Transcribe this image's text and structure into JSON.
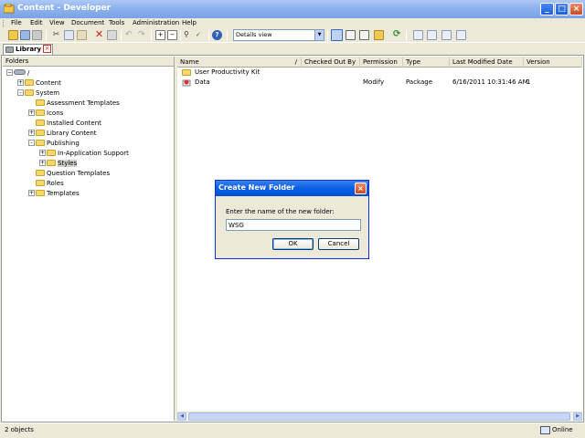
{
  "window": {
    "title": "Content - Developer"
  },
  "menu": [
    "File",
    "Edit",
    "View",
    "Document",
    "Tools",
    "Administration",
    "Help"
  ],
  "toolbar": {
    "view_select": "Details view"
  },
  "tabs": [
    {
      "label": "Library"
    }
  ],
  "folders": {
    "header": "Folders",
    "root": "/",
    "items": [
      {
        "label": "Content",
        "expander": "+"
      },
      {
        "label": "System",
        "expander": "-"
      },
      {
        "label": "Assessment Templates",
        "expander": ""
      },
      {
        "label": "Icons",
        "expander": "+"
      },
      {
        "label": "Installed Content",
        "expander": ""
      },
      {
        "label": "Library Content",
        "expander": "+"
      },
      {
        "label": "Publishing",
        "expander": "-"
      },
      {
        "label": "In-Application Support",
        "expander": "+"
      },
      {
        "label": "Styles",
        "expander": "+"
      },
      {
        "label": "Question Templates",
        "expander": ""
      },
      {
        "label": "Roles",
        "expander": ""
      },
      {
        "label": "Templates",
        "expander": "+"
      }
    ]
  },
  "list": {
    "columns": [
      "Name",
      "Checked Out By",
      "Permission",
      "Type",
      "Last Modified Date",
      "Version"
    ],
    "rows": [
      {
        "name": "User Productivity Kit",
        "checked_out_by": "",
        "permission": "",
        "type": "",
        "modified": "",
        "version": ""
      },
      {
        "name": "Data",
        "checked_out_by": "",
        "permission": "Modify",
        "type": "Package",
        "modified": "6/16/2011 10:31:46 AM",
        "version": "1"
      }
    ]
  },
  "status": {
    "count": "2 objects",
    "connection": "Online"
  },
  "dialog": {
    "title": "Create New Folder",
    "prompt": "Enter the name of the new folder:",
    "input_value": "WSG",
    "ok_label": "OK",
    "cancel_label": "Cancel"
  },
  "colors": {
    "titlebar": "#7aa2e6",
    "dialog_title": "#0a5fe3",
    "folder": "#f6d86a"
  }
}
